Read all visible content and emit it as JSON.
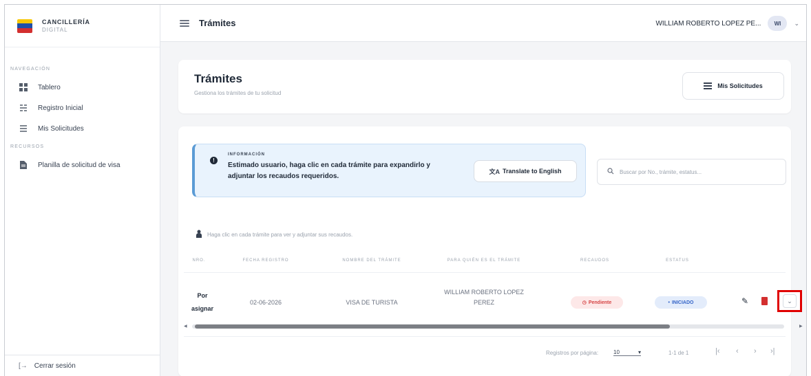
{
  "brand": {
    "title": "CANCILLERÍA",
    "subtitle": "DIGITAL"
  },
  "sidebar": {
    "nav_section": "NAVEGACIÓN",
    "nav_items": [
      {
        "label": "Tablero",
        "icon": "dashboard-icon"
      },
      {
        "label": "Registro Inicial",
        "icon": "registry-icon"
      },
      {
        "label": "Mis Solicitudes",
        "icon": "list-icon"
      }
    ],
    "resources_section": "RECURSOS",
    "resource_items": [
      {
        "label": "Planilla de solicitud de visa",
        "icon": "document-icon"
      }
    ],
    "logout_label": "Cerrar sesión"
  },
  "topbar": {
    "title": "Trámites",
    "user_name": "WILLIAM ROBERTO LOPEZ PE...",
    "user_initials": "WI"
  },
  "header": {
    "title": "Trámites",
    "subtitle": "Gestiona los trámites de tu solicitud",
    "button_label": "Mis Solicitudes"
  },
  "info": {
    "label": "INFORMACIÓN",
    "text": "Estimado usuario, haga clic en cada trámite para expandirlo y adjuntar los recaudos requeridos.",
    "translate_label": "Translate to English"
  },
  "search": {
    "placeholder": "Buscar por No., trámite, estatus..."
  },
  "hint": "Haga clic en cada trámite para ver y adjuntar sus recaudos.",
  "table": {
    "columns": [
      "NRO.",
      "FECHA REGISTRO",
      "NOMBRE DEL TRÁMITE",
      "PARA QUIÉN ES EL TRÁMITE",
      "RECAUDOS",
      "ESTATUS"
    ],
    "rows": [
      {
        "nro_line1": "Por",
        "nro_line2": "asignar",
        "fecha": "02-06-2026",
        "nombre": "VISA DE TURISTA",
        "para_line1": "WILLIAM ROBERTO LOPEZ",
        "para_line2": "PEREZ",
        "recaudos": "Pendiente",
        "estatus": "INICIADO"
      }
    ]
  },
  "pagination": {
    "rows_label": "Registros por página:",
    "rows_value": "10",
    "range": "1-1 de 1"
  },
  "colors": {
    "pending": "#d64545",
    "started": "#3464c8",
    "highlight": "#e00000",
    "info_bg": "#e9f3fd"
  }
}
